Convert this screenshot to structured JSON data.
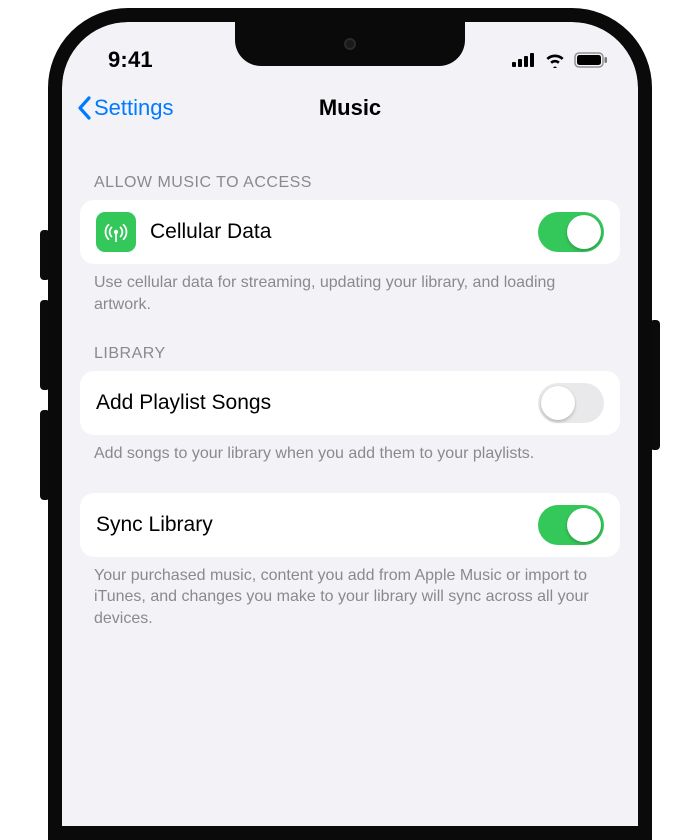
{
  "status": {
    "time": "9:41"
  },
  "nav": {
    "back": "Settings",
    "title": "Music"
  },
  "sections": {
    "access": {
      "header": "ALLOW MUSIC TO ACCESS",
      "cellular": {
        "label": "Cellular Data",
        "on": true
      },
      "footer": "Use cellular data for streaming, updating your library, and loading artwork."
    },
    "library": {
      "header": "LIBRARY",
      "add_playlist": {
        "label": "Add Playlist Songs",
        "on": false
      },
      "add_playlist_footer": "Add songs to your library when you add them to your playlists.",
      "sync": {
        "label": "Sync Library",
        "on": true
      },
      "sync_footer": "Your purchased music, content you add from Apple Music or import to iTunes, and changes you make to your library will sync across all your devices."
    }
  },
  "colors": {
    "tint": "#007aff",
    "toggle_on": "#34c759",
    "bg": "#f2f2f7"
  }
}
